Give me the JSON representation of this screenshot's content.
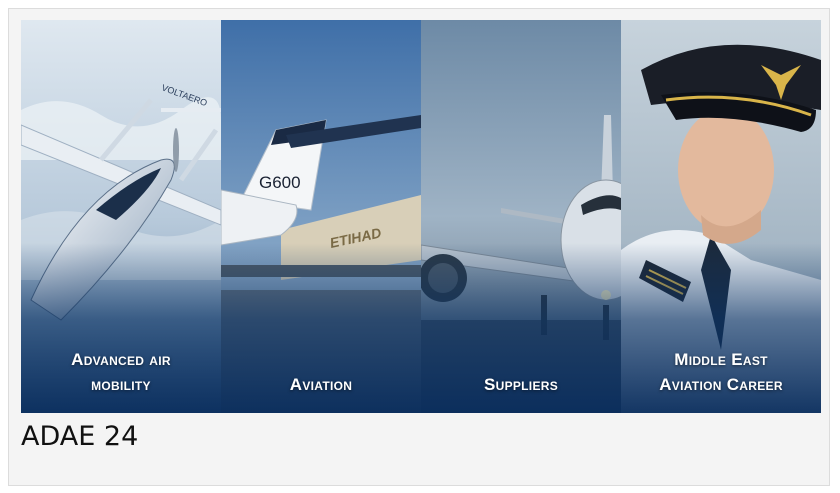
{
  "banner": {
    "panels": [
      {
        "label": "Advanced air\nmobility"
      },
      {
        "label": "Aviation",
        "tail_text": "G600",
        "livery_text": "ETIHAD"
      },
      {
        "label": "Suppliers"
      },
      {
        "label": "Middle East\nAviation Career"
      }
    ],
    "aircraft_text": "VOLTAERO"
  },
  "caption": "ADAE 24",
  "colors": {
    "banner_navy": "#0b2f5e",
    "label_text": "#ffffff",
    "card_bg": "#f4f4f4"
  }
}
